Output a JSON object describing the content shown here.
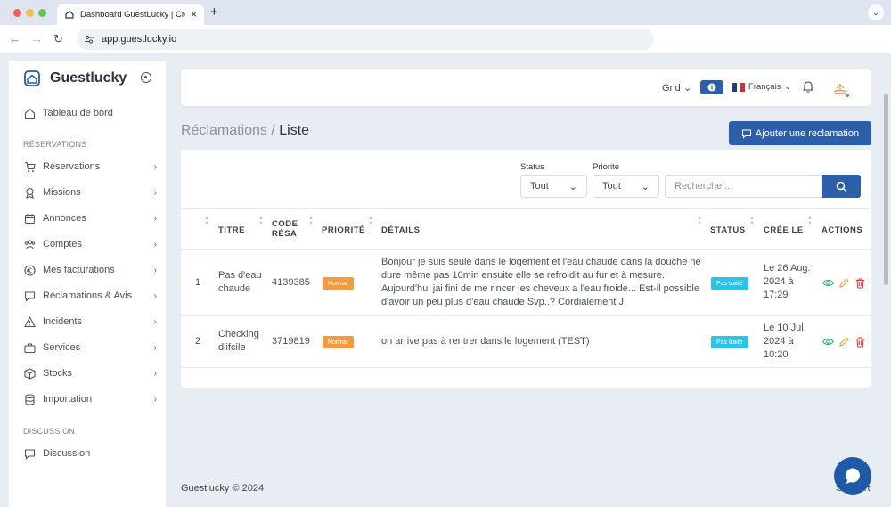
{
  "browser": {
    "tab_title": "Dashboard GuestLucky | Cre",
    "url": "app.guestlucky.io"
  },
  "sidebar": {
    "brand": "Guestlucky",
    "dashboard": "Tableau de bord",
    "section_reservations": "RÉSERVATIONS",
    "items": [
      {
        "label": "Réservations",
        "icon": "cart-icon"
      },
      {
        "label": "Missions",
        "icon": "award-icon"
      },
      {
        "label": "Annonces",
        "icon": "calendar-icon"
      },
      {
        "label": "Comptes",
        "icon": "users-icon"
      },
      {
        "label": "Mes facturations",
        "icon": "euro-icon"
      },
      {
        "label": "Réclamations & Avis",
        "icon": "message-icon"
      },
      {
        "label": "Incidents",
        "icon": "warning-icon"
      },
      {
        "label": "Services",
        "icon": "briefcase-icon"
      },
      {
        "label": "Stocks",
        "icon": "box-icon"
      },
      {
        "label": "Importation",
        "icon": "database-icon"
      }
    ],
    "section_discussion": "DISCUSSION",
    "discussion": "Discussion"
  },
  "topbar": {
    "grid": "Grid",
    "language": "Français"
  },
  "page": {
    "crumb_parent": "Réclamations /",
    "crumb_current": "Liste",
    "add_button": "Ajouter une reclamation"
  },
  "filters": {
    "status_label": "Status",
    "status_value": "Tout",
    "priority_label": "Priorité",
    "priority_value": "Tout",
    "search_placeholder": "Rechercher..."
  },
  "table": {
    "headers": {
      "titre": "TITRE",
      "code_1": "CODE",
      "code_2": "RÉSA",
      "priorite": "PRIORITÉ",
      "details": "DÉTAILS",
      "status": "STATUS",
      "cree": "CRÉE LE",
      "actions": "ACTIONS"
    },
    "rows": [
      {
        "num": "1",
        "titre_1": "Pas d'eau",
        "titre_2": "chaude",
        "code": "4139385",
        "priorite": "Normal",
        "details_1": "Bonjour je suis seule dans le logement et l'eau chaude dans la douche ne",
        "details_2": "dure même pas 10min ensuite elle se refroidit au fur et à mesure.",
        "details_3": "Aujourd'hui jai fini de me rincer les cheveux a l'eau froide... Est-il possible",
        "details_4": "d'avoir un peu plus d'eau chaude Svp..? Cordialement J",
        "status": "Pas traité",
        "cree_1": "Le 26 Aug.",
        "cree_2": "2024 à",
        "cree_3": "17:29"
      },
      {
        "num": "2",
        "titre_1": "Checking",
        "titre_2": "diifcile",
        "code": "3719819",
        "priorite": "Normal",
        "details_1": "on arrive pas à rentrer dans le logement (TEST)",
        "status": "Pas traité",
        "cree_1": "Le 10 Jul.",
        "cree_2": "2024 à",
        "cree_3": "10:20"
      }
    ]
  },
  "footer": {
    "copyright": "Guestlucky © 2024",
    "right": "Support"
  }
}
